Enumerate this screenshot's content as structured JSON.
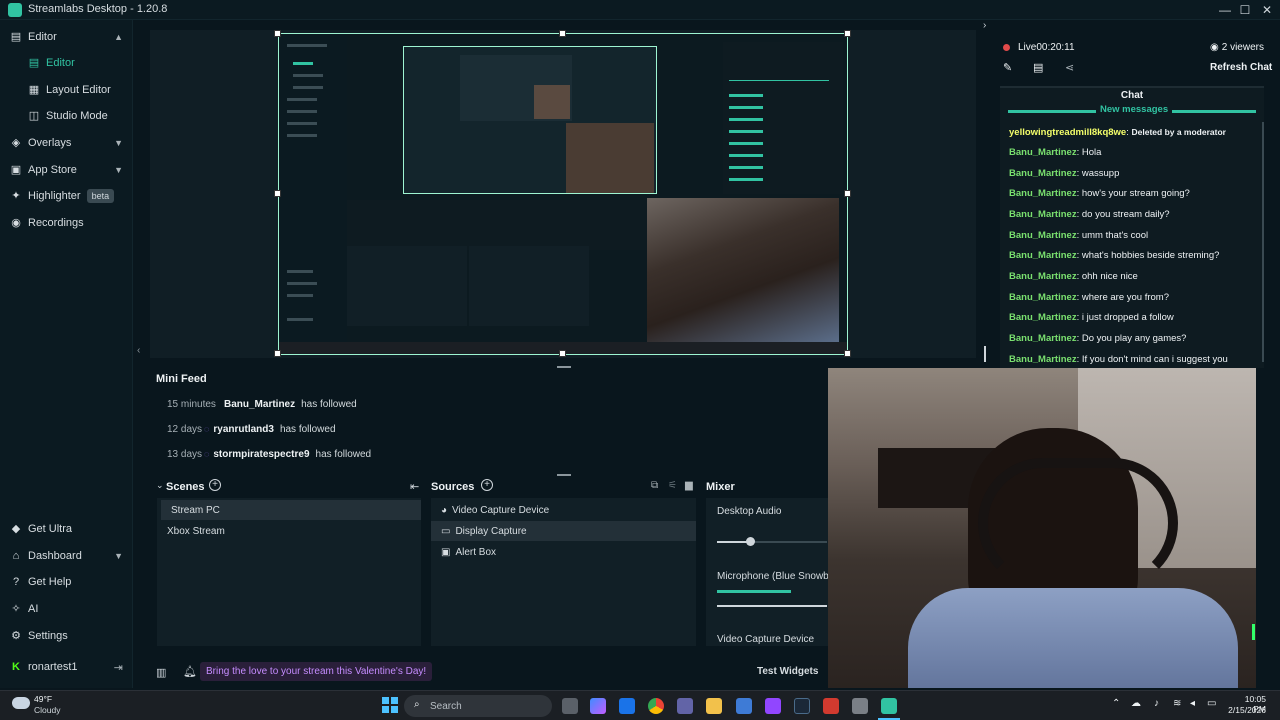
{
  "window": {
    "title": "Streamlabs Desktop - 1.20.8"
  },
  "sidebar": {
    "items": [
      {
        "label": "Editor"
      },
      {
        "label": "Editor"
      },
      {
        "label": "Layout Editor"
      },
      {
        "label": "Studio Mode"
      },
      {
        "label": "Overlays"
      },
      {
        "label": "App Store"
      },
      {
        "label": "Highlighter",
        "badge": "beta"
      },
      {
        "label": "Recordings"
      }
    ],
    "bottom": [
      {
        "label": "Get Ultra"
      },
      {
        "label": "Dashboard"
      },
      {
        "label": "Get Help"
      },
      {
        "label": "AI"
      },
      {
        "label": "Settings"
      },
      {
        "label": "ronartest1"
      }
    ]
  },
  "live": {
    "status": "Live",
    "time": "00:20:11",
    "viewers": "2 viewers",
    "refresh": "Refresh Chat"
  },
  "chat": {
    "title": "Chat",
    "new_messages": "New messages",
    "messages": [
      {
        "user": "yellowingtreadmill8kq8we",
        "text": "Deleted by a moderator",
        "deleted": true
      },
      {
        "user": "Banu_Martinez",
        "text": "Hola"
      },
      {
        "user": "Banu_Martinez",
        "text": "wassupp"
      },
      {
        "user": "Banu_Martinez",
        "text": "how's your stream going?"
      },
      {
        "user": "Banu_Martinez",
        "text": "do you stream daily?"
      },
      {
        "user": "Banu_Martinez",
        "text": "umm that's cool"
      },
      {
        "user": "Banu_Martinez",
        "text": "what's hobbies beside streming?"
      },
      {
        "user": "Banu_Martinez",
        "text": "ohh nice nice"
      },
      {
        "user": "Banu_Martinez",
        "text": "where are you from?"
      },
      {
        "user": "Banu_Martinez",
        "text": "i just dropped a follow"
      },
      {
        "user": "Banu_Martinez",
        "text": "Do you play any games?"
      },
      {
        "user": "Banu_Martinez",
        "text": "If you don't mind can i suggest you"
      }
    ]
  },
  "minifeed": {
    "title": "Mini Feed",
    "rows": [
      {
        "time": "15 minutes",
        "name": "Banu_Martinez",
        "action": "has followed"
      },
      {
        "time": "12 days",
        "name": "ryanrutland3",
        "action": "has followed"
      },
      {
        "time": "13 days",
        "name": "stormpiratespectre9",
        "action": "has followed"
      }
    ]
  },
  "scenes": {
    "title": "Scenes",
    "items": [
      "Stream PC",
      "Xbox Stream"
    ]
  },
  "sources": {
    "title": "Sources",
    "items": [
      "Video Capture Device",
      "Display Capture",
      "Alert Box"
    ]
  },
  "mixer": {
    "title": "Mixer",
    "items": [
      {
        "label": "Desktop Audio",
        "level": 0.3
      },
      {
        "label": "Microphone (Blue Snowball)"
      },
      {
        "label": "Video Capture Device"
      }
    ]
  },
  "footer": {
    "promo": "Bring the love to your stream this Valentine's Day!",
    "test_widgets": "Test Widgets"
  },
  "taskbar": {
    "weather_temp": "49°F",
    "weather_desc": "Cloudy",
    "search_placeholder": "Search",
    "time": "10:05 PM",
    "date": "2/15/2026"
  },
  "colors": {
    "accent": "#31c3a2",
    "chat_user": "#7ae06f",
    "promo": "#c58cff",
    "live_dot": "#e14a4a"
  }
}
